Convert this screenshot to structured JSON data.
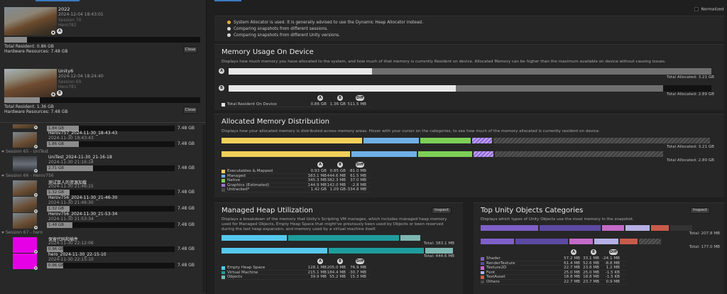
{
  "sidebar": {
    "snapshots": [
      {
        "name": "2022",
        "date": "2024-12-04 18:43:01",
        "session": "Session 70",
        "project": "Hero782",
        "badge": "A",
        "total_resident": "Total Resident: 0.86 GB",
        "hardware": "Hardware Resources: 7.48 GB",
        "fill": 0.115,
        "close": "Close"
      },
      {
        "name": "Unity6",
        "date": "2024-12-04 18:24:40",
        "session": "Session 69",
        "project": "Hero781",
        "badge": "B",
        "total_resident": "Total Resident: 1.36 GB",
        "hardware": "Hardware Resources: 7.48 GB",
        "fill": 0.18,
        "close": "Close"
      }
    ],
    "list": [
      {
        "type": "item",
        "title": "",
        "date": "",
        "bar": "1.84 GB",
        "fill": 0.25,
        "size": "7.48 GB",
        "thumb": "scene",
        "partial": true
      },
      {
        "type": "item",
        "title": "Herov757_2024-11-30_18-43-43",
        "date": "2024-11-30 18:43:43",
        "bar": "1.86 GB",
        "fill": 0.25,
        "size": "7.48 GB",
        "thumb": "scene"
      },
      {
        "type": "header",
        "label": "Session 65 - UniTest"
      },
      {
        "type": "item",
        "title": "UniTest_2024-11-30_21-16-18",
        "date": "2024-11-30 21:16:18",
        "bar": "2.71 GB",
        "fill": 0.36,
        "size": "7.48 GB",
        "thumb": "dark"
      },
      {
        "type": "header",
        "label": "Session 66 - Herov756"
      },
      {
        "type": "item",
        "title": "测试鼠人的资源加载",
        "date": "2024-11-30 21:46:15",
        "bar": "1.32 GB",
        "fill": 0.18,
        "size": "7.48 GB",
        "thumb": "scene"
      },
      {
        "type": "item",
        "title": "Herov756_2024-11-30_21-46-30",
        "date": "2024-11-30 21:46:30",
        "bar": "1.32 GB",
        "fill": 0.18,
        "size": "7.48 GB",
        "thumb": "scene"
      },
      {
        "type": "item",
        "title": "Herov756_2024-11-30_21-53-34",
        "date": "2024-11-30 21:53:34",
        "bar": "1.48 GB",
        "fill": 0.2,
        "size": "7.48 GB",
        "thumb": "scene"
      },
      {
        "type": "header",
        "label": "Session 67 - hero"
      },
      {
        "type": "item",
        "title": "保留代码和插件",
        "date": "2024-11-30 22:12:06",
        "bar": "0.96 GB",
        "fill": 0.13,
        "size": "7.48 GB",
        "thumb": "magenta"
      },
      {
        "type": "item",
        "title": "hero_2024-11-30_22-15-10",
        "date": "2024-11-30 22:15:10",
        "bar": "0.96 GB",
        "fill": 0.13,
        "size": "7.48 GB",
        "thumb": "magenta"
      }
    ]
  },
  "toolbar": {
    "normalized": "Normalized"
  },
  "warnings": [
    {
      "text": "System Allocator is used. It is generally advised to use the Dynamic Heap Allocator instead.",
      "color": "#e0b23a"
    },
    {
      "text": "Comparing snapshots from different sessions.",
      "color": "#d8d8d8"
    },
    {
      "text": "Comparing snapshots from different Unity versions.",
      "color": "#d8d8d8"
    }
  ],
  "memory_usage": {
    "title": "Memory Usage On Device",
    "desc": "Displays how much memory you have allocated to the system, and how much of that memory is currently Resident on device. Allocated Memory can be higher than the maximum available on device without causing issues.",
    "bars": [
      {
        "badge": "A",
        "resident": 0.297,
        "allocated": 1.0,
        "total": "Total Allocated: 3.21 GB"
      },
      {
        "badge": "B",
        "resident": 0.47,
        "allocated": 0.9,
        "total": "Total Allocated: 2.89 GB"
      }
    ],
    "cols": [
      "A",
      "B",
      "Diff"
    ],
    "row": {
      "label": "Total Resident On Device",
      "a": "0.86 GB",
      "b": "1.36 GB",
      "diff": "511.5 MB"
    }
  },
  "allocated": {
    "title": "Allocated Memory Distribution",
    "desc": "Displays how your allocated memory is distributed across memory areas. Hover with your cursor on the categories, to see how much of the memory allocated is currently resident on device.",
    "totals": [
      "Total Allocated: 3.21 GB",
      "Total Allocated: 2.89 GB"
    ],
    "cols": [
      "A",
      "B",
      "Diff"
    ],
    "rows": [
      {
        "name": "Executables & Mapped",
        "color": "#f0cf5a",
        "a": "0.93 GB",
        "b": "0.85 GB",
        "diff": "-81.0 MB"
      },
      {
        "name": "Managed",
        "color": "#6fb0e6",
        "a": "383.1 MB",
        "b": "444.6 MB",
        "diff": "61.5 MB"
      },
      {
        "name": "Native",
        "color": "#7dcf57",
        "a": "345.3 MB",
        "b": "382.3 MB",
        "diff": "37.0 MB"
      },
      {
        "name": "Graphics (Estimated)",
        "color": "#9b74e0",
        "a": "144.9 MB",
        "b": "142.0 MB",
        "diff": "-2.8 MB"
      },
      {
        "name": "Untracked*",
        "color": "#4a4a4a",
        "a": "1.42 GB",
        "b": "1.09 GB",
        "diff": "-334.8 MB"
      }
    ]
  },
  "managed": {
    "title": "Managed Heap Utilization",
    "inspect": "Inspect",
    "desc": "Displays a breakdown of the memory that Unity's Scripting VM manages, which includes managed heap memory used for Managed Objects, Empty Heap Space that might've previously been used by Objects or been reserved during the last heap expansion, and memory used by a virtual machine itself.",
    "totals": [
      "Total: 383.1 MB",
      "Total: 444.6 MB"
    ],
    "cols": [
      "A",
      "B",
      "Diff"
    ],
    "rows": [
      {
        "name": "Empty Heap Space",
        "color": "#55c8ef",
        "a": "128.1 MB",
        "b": "205.0 MB",
        "diff": "76.9 MB"
      },
      {
        "name": "Virtual Machine",
        "color": "#1e9c9c",
        "a": "215.1 MB",
        "b": "184.4 MB",
        "diff": "-30.7 MB"
      },
      {
        "name": "Objects",
        "color": "#7fb7b2",
        "a": "39.9 MB",
        "b": "55.2 MB",
        "diff": "15.3 MB"
      }
    ]
  },
  "top_objects": {
    "title": "Top Unity Objects Categories",
    "inspect": "Inspect",
    "desc": "Displays which types of Unity Objects use the most memory in the snapshot.",
    "totals": [
      "Total: 207.8 MB",
      "Total: 177.0 MB"
    ],
    "cols": [
      "A",
      "B",
      "Diff"
    ],
    "rows": [
      {
        "name": "Shader",
        "color": "#7f5fc9",
        "a": "57.2 MB",
        "b": "33.1 MB",
        "diff": "-24.1 MB"
      },
      {
        "name": "RenderTexture",
        "color": "#5c4aa3",
        "a": "61.4 MB",
        "b": "52.6 MB",
        "diff": "-8.8 MB"
      },
      {
        "name": "Texture2D",
        "color": "#c46ac9",
        "a": "22.7 MB",
        "b": "23.8 MB",
        "diff": "1.2 MB"
      },
      {
        "name": "Font",
        "color": "#b6b0e6",
        "a": "25.0 MB",
        "b": "25.0 MB",
        "diff": "-1.5 KB"
      },
      {
        "name": "TextAsset",
        "color": "#c95a4a",
        "a": "18.8 MB",
        "b": "18.8 MB",
        "diff": "-1.5 KB"
      },
      {
        "name": "Others",
        "color": "#4a4a4a",
        "a": "22.7 MB",
        "b": "23.7 MB",
        "diff": "0.9 MB"
      }
    ]
  }
}
